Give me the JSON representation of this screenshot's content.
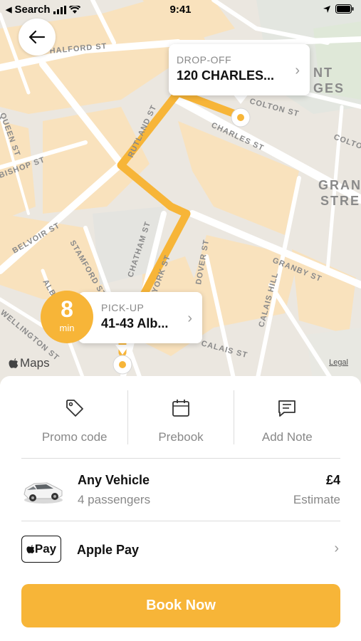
{
  "status_bar": {
    "back_app": "Search",
    "time": "9:41"
  },
  "map": {
    "streets": [
      "HALFORD ST",
      "RUTLAND ST",
      "CHARLES ST",
      "BELVOIR ST",
      "STAMFORD ST",
      "CHATHAM ST",
      "GRANBY ST",
      "CALAIS HILL",
      "BISHOP ST",
      "COLTON ST",
      "YORK ST",
      "ALBION ST",
      "WELLINGTON ST",
      "DOVER ST",
      "CALAIS ST",
      "QUEEN ST",
      "GRANBY STREET",
      "ST GEORGES"
    ],
    "maps_label": "Maps",
    "legal_label": "Legal",
    "route_color": "#F7B538"
  },
  "dropoff": {
    "label": "DROP-OFF",
    "address": "120 CHARLES..."
  },
  "pickup": {
    "label": "PICK-UP",
    "address": "41-43 Alb..."
  },
  "eta": {
    "value": "8",
    "unit": "min"
  },
  "actions": [
    {
      "label": "Promo code",
      "icon": "tag-icon"
    },
    {
      "label": "Prebook",
      "icon": "calendar-icon"
    },
    {
      "label": "Add Note",
      "icon": "note-icon"
    }
  ],
  "vehicle": {
    "name": "Any Vehicle",
    "passengers": "4 passengers",
    "price": "£4",
    "price_note": "Estimate"
  },
  "payment": {
    "badge": "Pay",
    "method": "Apple Pay"
  },
  "book_button": {
    "label": "Book Now",
    "color": "#F7B538"
  }
}
